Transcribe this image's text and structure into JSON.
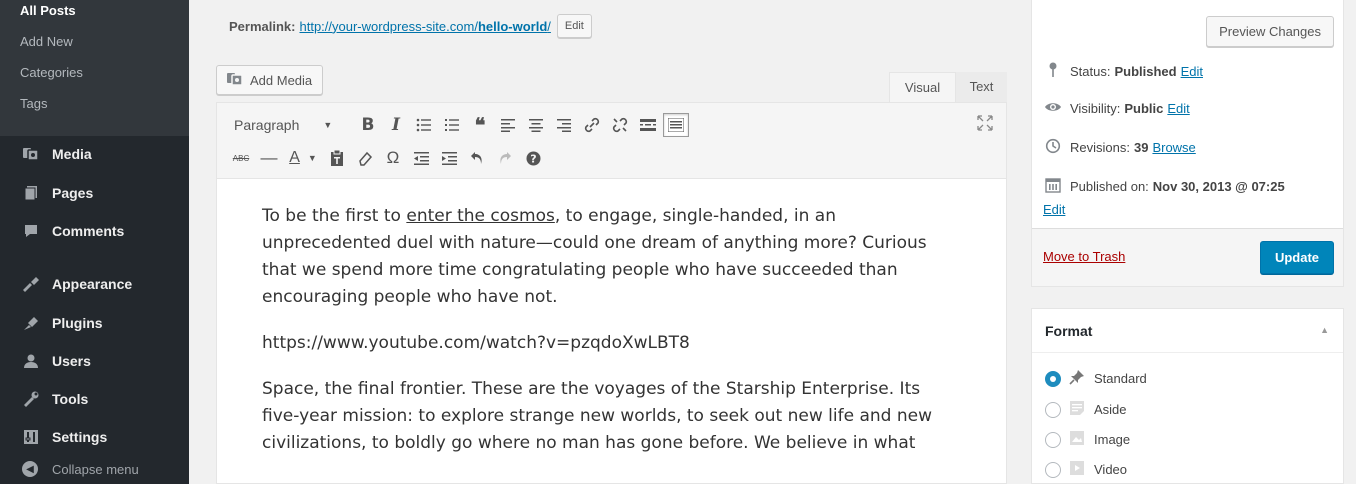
{
  "sidebar": {
    "submenu": [
      "All Posts",
      "Add New",
      "Categories",
      "Tags"
    ],
    "menu": [
      {
        "label": "Media",
        "icon": "media-icon"
      },
      {
        "label": "Pages",
        "icon": "pages-icon"
      },
      {
        "label": "Comments",
        "icon": "comments-icon"
      },
      {
        "label": "Appearance",
        "icon": "appearance-icon"
      },
      {
        "label": "Plugins",
        "icon": "plugins-icon"
      },
      {
        "label": "Users",
        "icon": "users-icon"
      },
      {
        "label": "Tools",
        "icon": "tools-icon"
      },
      {
        "label": "Settings",
        "icon": "settings-icon"
      }
    ],
    "collapse_label": "Collapse menu"
  },
  "permalink": {
    "label": "Permalink:",
    "url_base": "http://your-wordpress-site.com/",
    "url_slug": "hello-world",
    "url_trail": "/",
    "edit_label": "Edit"
  },
  "editor": {
    "add_media_label": "Add Media",
    "tab_visual": "Visual",
    "tab_text": "Text",
    "format_select": "Paragraph",
    "content": {
      "p1_before": "To be the first to ",
      "p1_link": "enter the cosmos",
      "p1_after": ", to engage, single-handed, in an unprecedented duel with nature—could one dream of anything more? Curious that we spend more time congratulating people who have succeeded than encouraging people who have not.",
      "p2": "https://www.youtube.com/watch?v=pzqdoXwLBT8",
      "p3": "Space, the final frontier. These are the voyages of the Starship Enterprise. Its five-year mission: to explore strange new worlds, to seek out new life and new civilizations, to boldly go where no man has gone before. We believe in what"
    }
  },
  "publish": {
    "preview_label": "Preview Changes",
    "status_label": "Status:",
    "status_value": "Published",
    "status_edit": "Edit",
    "visibility_label": "Visibility:",
    "visibility_value": "Public",
    "visibility_edit": "Edit",
    "revisions_label": "Revisions:",
    "revisions_value": "39",
    "revisions_browse": "Browse",
    "published_label": "Published on:",
    "published_value": "Nov 30, 2013 @ 07:25",
    "published_edit": "Edit",
    "trash_label": "Move to Trash",
    "update_label": "Update"
  },
  "format": {
    "title": "Format",
    "options": [
      "Standard",
      "Aside",
      "Image",
      "Video"
    ],
    "selected": "Standard"
  },
  "colors": {
    "sidebar_bg": "#23282d",
    "submenu_bg": "#32373c",
    "primary_button": "#0085ba",
    "link": "#0073aa",
    "trash": "#a00"
  }
}
